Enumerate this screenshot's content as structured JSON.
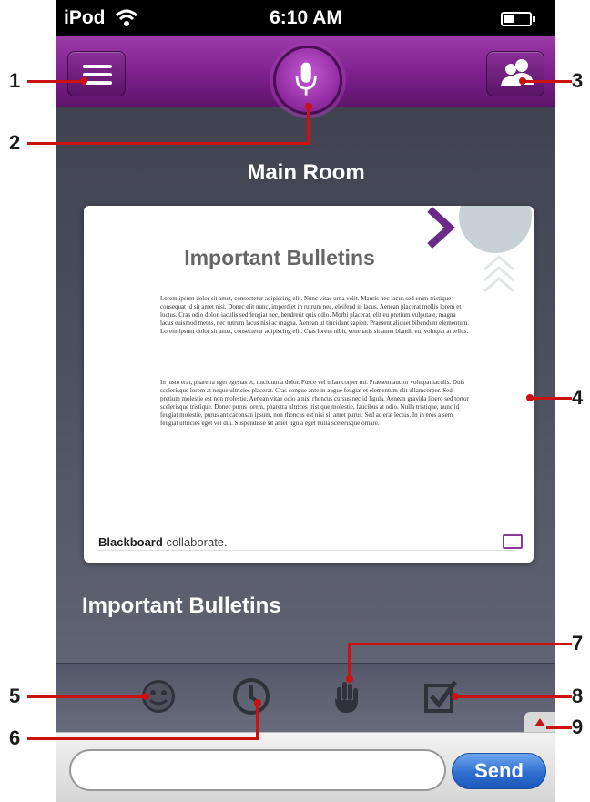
{
  "status_bar": {
    "carrier": "iPod",
    "time": "6:10 AM",
    "wifi_icon": "wifi-icon",
    "battery_icon": "battery-icon"
  },
  "top_bar": {
    "menu_icon": "menu-icon",
    "mic_icon": "microphone-icon",
    "participants_icon": "participants-icon",
    "accent_color": "#7c1f8c"
  },
  "room": {
    "title": "Main Room"
  },
  "slide": {
    "title": "Important Bulletins",
    "paragraph_1": "Lorem ipsum dolor sit amet, consectetur adipiscing elit. Nunc vitae urna velit. Mauris nec lacus sed enim tristique consequat id sit amet nisi. Donec elit nunc, imperdiet in rutrum nec, eleifend in lacus. Aenean placerat mollis lorem et luctus. Cras odio dolor, iaculis sed feugiat nec, hendrerit quis odio. Morbi placerat, elit eu pretium vulputate, magna lacus euismod metus, nec rutrum lacus nisi ac magna. Aenean ut tincidunt sapien. Praesent aliquet bibendum elementum. Lorem ipsum dolor sit amet, consectetur adipiscing elit. Cras lorem nibh, venenatis sit amet blandit eu, volutpat at tellus.",
    "paragraph_2": "In justo erat, pharetra eget egestas et, tincidunt a dolor. Fusce vel ullamcorper mi. Praesent auctor volutpat iaculis. Duis scelerisque lorem at neque ultricies placerat. Cras congue ante in augue feugiat et elementum elit ullamcorper. Sed pretium molestie est non molestie. Aenean vitae odio a nisl rhoncus cursus nec id ligula. Aenean gravida libero sed tortor scelerisque tristique. Donec purus lorem, pharetra ultrices tristique molestie, faucibus at odio. Nulla tristique, nunc id feugiat molestie, purus anticaconsan ipsum, non rhoncus est nisi sit amet purus. Sed ac erat lectus. In in eros a sem feugiat ultricies eget vel dui. Suspendisse sit amet ligula eget nulla scelerisque ornare.",
    "brand_bold": "Blackboard",
    "brand_light": "collaborate."
  },
  "content_heading": "Important Bulletins",
  "toolbar": {
    "items": [
      {
        "icon": "emoticon-icon"
      },
      {
        "icon": "away-clock-icon"
      },
      {
        "icon": "raise-hand-icon"
      },
      {
        "icon": "poll-check-icon"
      }
    ]
  },
  "chat": {
    "input_value": "",
    "send_label": "Send"
  },
  "callouts": [
    "1",
    "2",
    "3",
    "4",
    "5",
    "6",
    "7",
    "8",
    "9"
  ],
  "colors": {
    "callout_red": "#cc1111",
    "send_blue": "#2f6fd0"
  }
}
